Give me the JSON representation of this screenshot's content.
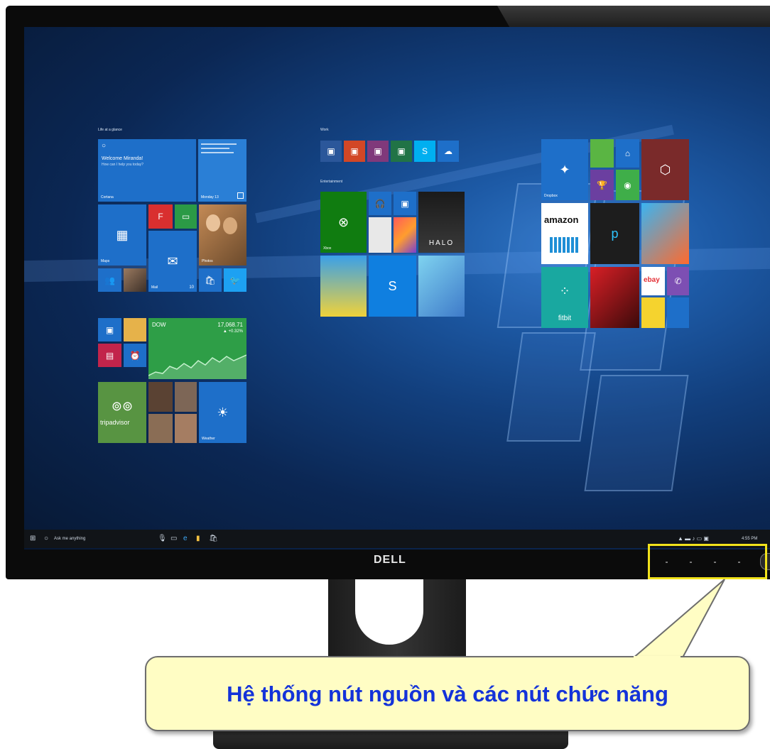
{
  "brand": "DELL",
  "callout": {
    "text": "Hệ thống nút nguồn và các nút chức năng"
  },
  "colors": {
    "highlight": "#f1e21b",
    "callout_bg": "#fffdc4",
    "callout_text": "#1433d9",
    "tile_blue": "#1e6fc9"
  },
  "start_screen": {
    "groups": [
      "Life at a glance",
      "Work",
      "Entertainment"
    ],
    "tiles": {
      "cortana": {
        "title": "Welcome Miranda!",
        "subtitle": "How can I help you today?",
        "caption": "Cortana"
      },
      "calendar": {
        "caption": "Monday 13"
      },
      "maps": {
        "caption": "Maps"
      },
      "mail": {
        "caption": "Mail",
        "badge": "10"
      },
      "photos": {
        "caption": "Photos"
      },
      "xbox": {
        "caption": "Xbox"
      },
      "dropbox": {
        "caption": "Dropbox"
      },
      "halo": {
        "text": "HALO"
      },
      "money": {
        "name": "DOW",
        "value": "17,068.71",
        "change": "▲ +0.32%"
      },
      "amazon": {
        "text": "amazon"
      },
      "fitbit": {
        "text": "fitbit"
      },
      "tripadvisor": {
        "text": "tripadvisor"
      },
      "ebay": {
        "text": "ebay"
      },
      "weather": {
        "caption": "Weather"
      }
    }
  },
  "taskbar": {
    "search_placeholder": "Ask me anything",
    "time": "4:55 PM",
    "icons": [
      "windows-start",
      "search",
      "microphone",
      "task-view",
      "edge",
      "file-explorer",
      "store"
    ]
  }
}
